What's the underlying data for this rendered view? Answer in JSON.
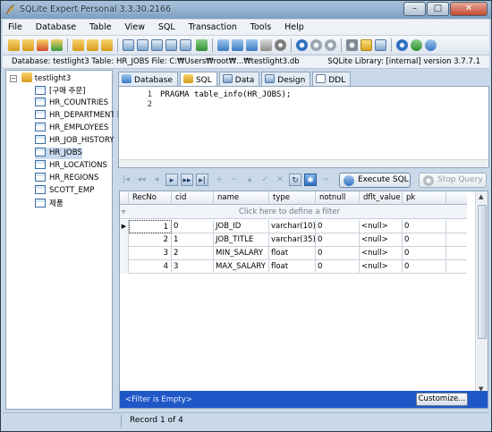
{
  "window": {
    "title": "SQLite Expert Personal 3.3.30.2166",
    "buttons": {
      "minimize": "–",
      "maximize": "□",
      "close": "✕"
    }
  },
  "menu": [
    "File",
    "Database",
    "Table",
    "View",
    "SQL",
    "Transaction",
    "Tools",
    "Help"
  ],
  "infobar": {
    "left": "Database: testlight3   Table: HR_JOBS   File: C:₩Users₩root₩...₩testlight3.db",
    "right": "SQLite Library: [internal] version 3.7.7.1"
  },
  "tree": {
    "root": "testlight3",
    "items": [
      "[구매 주문]",
      "HR_COUNTRIES",
      "HR_DEPARTMENTS",
      "HR_EMPLOYEES",
      "HR_JOB_HISTORY",
      "HR_JOBS",
      "HR_LOCATIONS",
      "HR_REGIONS",
      "SCOTT_EMP",
      "제품"
    ],
    "selected": "HR_JOBS"
  },
  "tabs": [
    "Database",
    "SQL",
    "Data",
    "Design",
    "DDL"
  ],
  "active_tab": "SQL",
  "editor": {
    "line_numbers": [
      "1",
      "2"
    ],
    "lines": [
      "PRAGMA table_info(HR_JOBS);",
      ""
    ]
  },
  "nav": {
    "buttons": [
      "|◂",
      "◂◂",
      "◂",
      "▸",
      "▸▸",
      "▸|",
      "+",
      "−",
      "▴",
      "✓",
      "✕",
      "↻",
      "✱",
      "⤳"
    ],
    "execute_label": "Execute SQL",
    "stop_label": "Stop Query"
  },
  "grid": {
    "columns": [
      "RecNo",
      "cid",
      "name",
      "type",
      "notnull",
      "dflt_value",
      "pk"
    ],
    "filter_hint": "Click here to define a filter",
    "rows": [
      [
        "1",
        "0",
        "JOB_ID",
        "varchar(10)",
        "0",
        "<null>",
        "0"
      ],
      [
        "2",
        "1",
        "JOB_TITLE",
        "varchar(35)",
        "0",
        "<null>",
        "0"
      ],
      [
        "3",
        "2",
        "MIN_SALARY",
        "float",
        "0",
        "<null>",
        "0"
      ],
      [
        "4",
        "3",
        "MAX_SALARY",
        "float",
        "0",
        "<null>",
        "0"
      ]
    ],
    "footer_text": "<Filter is Empty>",
    "customize_label": "Customize..."
  },
  "status": {
    "record": "Record 1 of 4"
  },
  "colors": {
    "accent": "#1f57c7",
    "chrome": "#c9d9ea",
    "selection": "#c7daf0"
  }
}
